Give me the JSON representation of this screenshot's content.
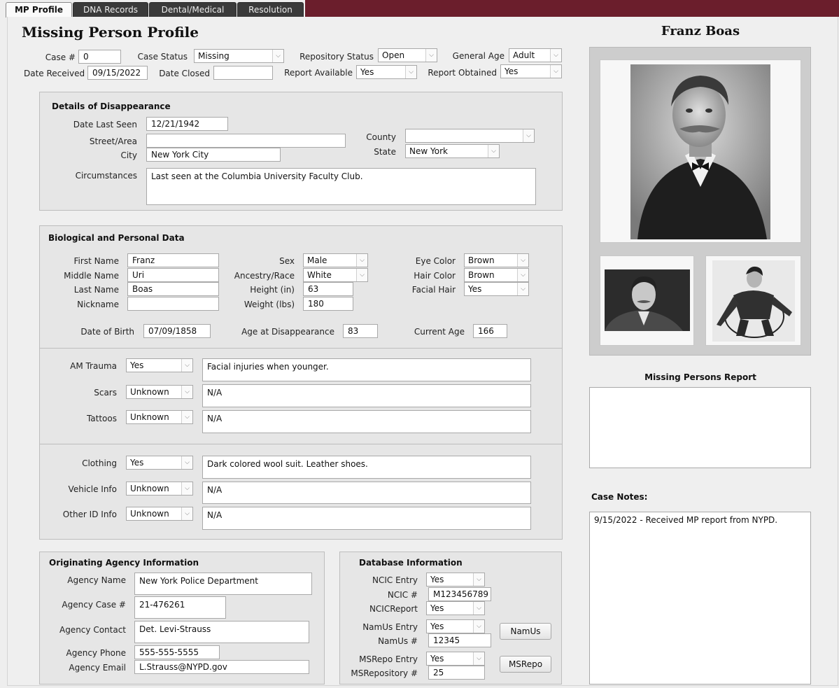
{
  "tabs": [
    "MP Profile",
    "DNA Records",
    "Dental/Medical",
    "Resolution"
  ],
  "page_title": "Missing Person Profile",
  "person_name": "Franz Boas",
  "header": {
    "case_label": "Case #",
    "case_value": "0",
    "case_status_label": "Case Status",
    "case_status_value": "Missing",
    "repo_status_label": "Repository Status",
    "repo_status_value": "Open",
    "general_age_label": "General Age",
    "general_age_value": "Adult",
    "date_received_label": "Date Received",
    "date_received_value": "09/15/2022",
    "date_closed_label": "Date Closed",
    "date_closed_value": "",
    "report_available_label": "Report Available",
    "report_available_value": "Yes",
    "report_obtained_label": "Report Obtained",
    "report_obtained_value": "Yes"
  },
  "disappearance": {
    "title": "Details of Disappearance",
    "date_last_seen_label": "Date Last Seen",
    "date_last_seen_value": "12/21/1942",
    "street_label": "Street/Area",
    "street_value": "",
    "city_label": "City",
    "city_value": "New York City",
    "county_label": "County",
    "county_value": "",
    "state_label": "State",
    "state_value": "New York",
    "circumstances_label": "Circumstances",
    "circumstances_value": "Last seen at the Columbia University Faculty Club."
  },
  "bio": {
    "title": "Biological and Personal Data",
    "first_name_label": "First Name",
    "first_name_value": "Franz",
    "middle_name_label": "Middle Name",
    "middle_name_value": "Uri",
    "last_name_label": "Last Name",
    "last_name_value": "Boas",
    "nickname_label": "Nickname",
    "nickname_value": "",
    "sex_label": "Sex",
    "sex_value": "Male",
    "ancestry_label": "Ancestry/Race",
    "ancestry_value": "White",
    "height_label": "Height (in)",
    "height_value": "63",
    "weight_label": "Weight (lbs)",
    "weight_value": "180",
    "eye_label": "Eye Color",
    "eye_value": "Brown",
    "hair_label": "Hair Color",
    "hair_value": "Brown",
    "facial_hair_label": "Facial Hair",
    "facial_hair_value": "Yes",
    "dob_label": "Date of Birth",
    "dob_value": "07/09/1858",
    "age_dis_label": "Age at Disappearance",
    "age_dis_value": "83",
    "current_age_label": "Current Age",
    "current_age_value": "166"
  },
  "marks": {
    "am_trauma_label": "AM Trauma",
    "am_trauma_value": "Yes",
    "am_trauma_text": "Facial injuries when younger.",
    "scars_label": "Scars",
    "scars_value": "Unknown",
    "scars_text": "N/A",
    "tattoos_label": "Tattoos",
    "tattoos_value": "Unknown",
    "tattoos_text": "N/A"
  },
  "items": {
    "clothing_label": "Clothing",
    "clothing_value": "Yes",
    "clothing_text": "Dark colored wool suit. Leather shoes.",
    "vehicle_label": "Vehicle Info",
    "vehicle_value": "Unknown",
    "vehicle_text": "N/A",
    "other_label": "Other ID Info",
    "other_value": "Unknown",
    "other_text": "N/A"
  },
  "agency": {
    "title": "Originating Agency Information",
    "name_label": "Agency Name",
    "name_value": "New York Police Department",
    "case_label": "Agency Case #",
    "case_value": "21-476261",
    "contact_label": "Agency Contact",
    "contact_value": "Det. Levi-Strauss",
    "phone_label": "Agency Phone",
    "phone_value": "555-555-5555",
    "email_label": "Agency Email",
    "email_value": "L.Strauss@NYPD.gov"
  },
  "database": {
    "title": "Database Information",
    "ncic_entry_label": "NCIC Entry",
    "ncic_entry_value": "Yes",
    "ncic_num_label": "NCIC #",
    "ncic_num_value": "M123456789",
    "ncic_report_label": "NCICReport",
    "ncic_report_value": "Yes",
    "namus_entry_label": "NamUs Entry",
    "namus_entry_value": "Yes",
    "namus_num_label": "NamUs #",
    "namus_num_value": "12345",
    "namus_button": "NamUs",
    "msrepo_entry_label": "MSRepo Entry",
    "msrepo_entry_value": "Yes",
    "msrepo_num_label": "MSRepository #",
    "msrepo_num_value": "25",
    "msrepo_button": "MSRepo"
  },
  "report_title": "Missing Persons Report",
  "case_notes_title": "Case Notes:",
  "case_notes_value": "9/15/2022 - Received MP report from NYPD.",
  "colors": {
    "topbar": "#6b1e2c",
    "panel": "#e6e6e6",
    "background": "#efefef"
  }
}
